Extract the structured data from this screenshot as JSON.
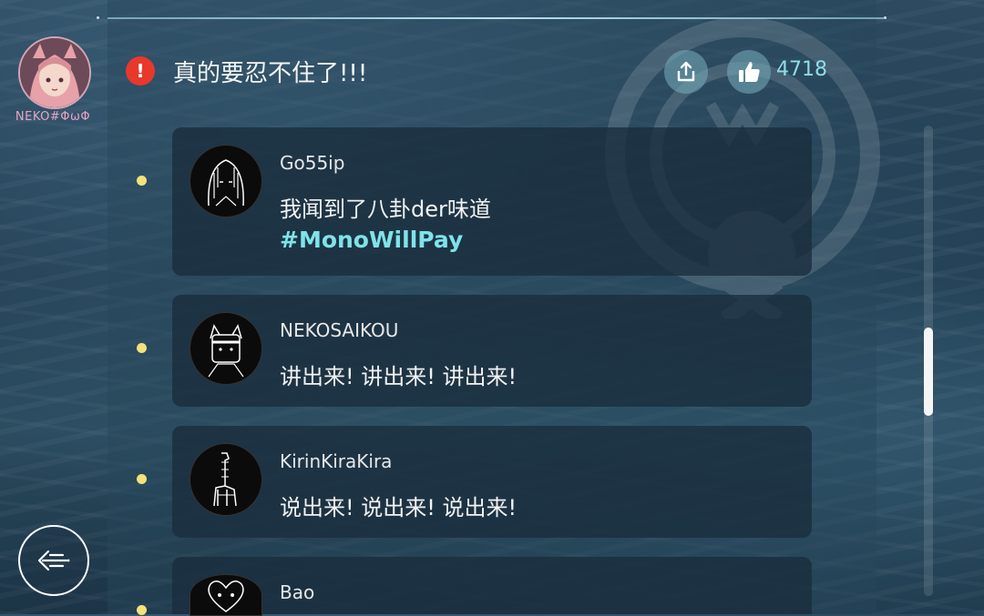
{
  "user": {
    "name": "NEKO#ΦωΦ"
  },
  "post": {
    "title": "真的要忍不住了!!!",
    "likes": "4718"
  },
  "colors": {
    "accent": "#7fe3ea",
    "alert": "#e8382c",
    "bullet": "#f2e27a",
    "username": "#e5a6c3"
  },
  "icons": {
    "alert": "exclamation-icon",
    "share": "share-icon",
    "like": "thumbs-up-icon",
    "back": "back-arrow-icon"
  },
  "comments": [
    {
      "author": "Go55ip",
      "text": "我闻到了八卦der味道",
      "tag": "#MonoWillPay"
    },
    {
      "author": "NEKOSAIKOU",
      "text": "讲出来! 讲出来! 讲出来!"
    },
    {
      "author": "KirinKiraKira",
      "text": "说出来! 说出来! 说出来!"
    },
    {
      "author": "Bao"
    }
  ]
}
